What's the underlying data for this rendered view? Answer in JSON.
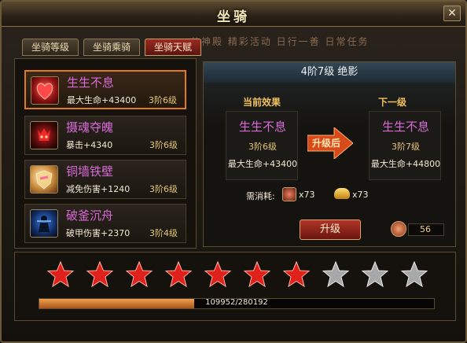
{
  "window": {
    "title": "坐骑"
  },
  "tabs": [
    {
      "label": "坐骑等级",
      "active": false
    },
    {
      "label": "坐骑乘骑",
      "active": false
    },
    {
      "label": "坐骑天赋",
      "active": true
    }
  ],
  "background_text": "分神殿 精彩活动 日行一善 日常任务",
  "skills": [
    {
      "name": "生生不息",
      "effect": "最大生命+43400",
      "level": "3阶6级",
      "icon": "heart-icon",
      "selected": true
    },
    {
      "name": "摄魂夺魄",
      "effect": "暴击+4340",
      "level": "3阶6级",
      "icon": "demon-icon",
      "selected": false
    },
    {
      "name": "铜墙铁壁",
      "effect": "减免伤害+1240",
      "level": "3阶6级",
      "icon": "shield-icon",
      "selected": false
    },
    {
      "name": "破釜沉舟",
      "effect": "破甲伤害+2370",
      "level": "3阶4级",
      "icon": "warrior-icon",
      "selected": false
    }
  ],
  "detail": {
    "header": "4阶7级   绝影",
    "current_heading": "当前效果",
    "next_heading": "下一级",
    "current": {
      "name": "生生不息",
      "level": "3阶6级",
      "stat": "最大生命+43400"
    },
    "next": {
      "name": "生生不息",
      "level": "3阶7级",
      "stat": "最大生命+44800"
    },
    "arrow_label": "升级后",
    "cost_label": "需消耗:",
    "cost_items": [
      {
        "icon": "material-icon",
        "count": "x73"
      },
      {
        "icon": "gold-ingot-icon",
        "count": "x73"
      }
    ],
    "upgrade_button": "升级",
    "owned_count": "56"
  },
  "stars": {
    "filled": 7,
    "total": 10
  },
  "progress": {
    "current": 109952,
    "max": 280192,
    "label": "109952/280192"
  },
  "colors": {
    "skill_name": "#d86ad8",
    "level": "#e5c77a",
    "star_filled": "#e0201a",
    "star_empty": "#a8a8a8",
    "accent": "#e07a1a"
  }
}
